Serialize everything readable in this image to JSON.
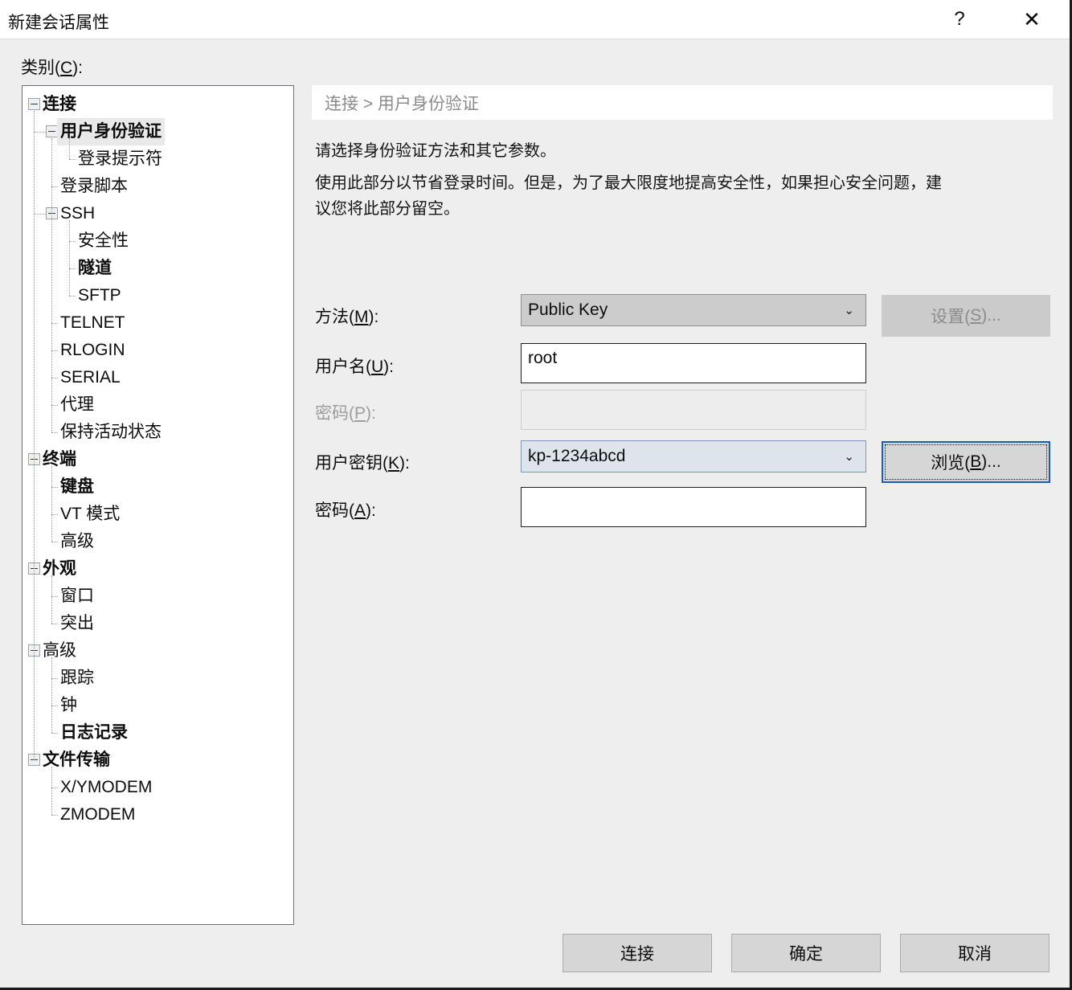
{
  "window": {
    "title": "新建会话属性",
    "help_icon": "?",
    "close_icon": "✕"
  },
  "category": {
    "label_pre": "类别(",
    "label_key": "C",
    "label_post": "):"
  },
  "tree": {
    "items": [
      {
        "label": "连接",
        "level": 0,
        "expander": true,
        "bold": true,
        "selected": false
      },
      {
        "label": "用户身份验证",
        "level": 1,
        "expander": true,
        "bold": true,
        "selected": true
      },
      {
        "label": "登录提示符",
        "level": 2,
        "expander": false,
        "bold": false,
        "selected": false
      },
      {
        "label": "登录脚本",
        "level": 1,
        "expander": false,
        "bold": false,
        "selected": false
      },
      {
        "label": "SSH",
        "level": 1,
        "expander": true,
        "bold": false,
        "selected": false
      },
      {
        "label": "安全性",
        "level": 2,
        "expander": false,
        "bold": false,
        "selected": false
      },
      {
        "label": "隧道",
        "level": 2,
        "expander": false,
        "bold": true,
        "selected": false
      },
      {
        "label": "SFTP",
        "level": 2,
        "expander": false,
        "bold": false,
        "selected": false
      },
      {
        "label": "TELNET",
        "level": 1,
        "expander": false,
        "bold": false,
        "selected": false
      },
      {
        "label": "RLOGIN",
        "level": 1,
        "expander": false,
        "bold": false,
        "selected": false
      },
      {
        "label": "SERIAL",
        "level": 1,
        "expander": false,
        "bold": false,
        "selected": false
      },
      {
        "label": "代理",
        "level": 1,
        "expander": false,
        "bold": false,
        "selected": false
      },
      {
        "label": "保持活动状态",
        "level": 1,
        "expander": false,
        "bold": false,
        "selected": false
      },
      {
        "label": "终端",
        "level": 0,
        "expander": true,
        "bold": true,
        "selected": false
      },
      {
        "label": "键盘",
        "level": 1,
        "expander": false,
        "bold": true,
        "selected": false
      },
      {
        "label": "VT 模式",
        "level": 1,
        "expander": false,
        "bold": false,
        "selected": false
      },
      {
        "label": "高级",
        "level": 1,
        "expander": false,
        "bold": false,
        "selected": false
      },
      {
        "label": "外观",
        "level": 0,
        "expander": true,
        "bold": true,
        "selected": false
      },
      {
        "label": "窗口",
        "level": 1,
        "expander": false,
        "bold": false,
        "selected": false
      },
      {
        "label": "突出",
        "level": 1,
        "expander": false,
        "bold": false,
        "selected": false
      },
      {
        "label": "高级",
        "level": 0,
        "expander": true,
        "bold": false,
        "selected": false
      },
      {
        "label": "跟踪",
        "level": 1,
        "expander": false,
        "bold": false,
        "selected": false
      },
      {
        "label": "钟",
        "level": 1,
        "expander": false,
        "bold": false,
        "selected": false
      },
      {
        "label": "日志记录",
        "level": 1,
        "expander": false,
        "bold": true,
        "selected": false
      },
      {
        "label": "文件传输",
        "level": 0,
        "expander": true,
        "bold": true,
        "selected": false
      },
      {
        "label": "X/YMODEM",
        "level": 1,
        "expander": false,
        "bold": false,
        "selected": false
      },
      {
        "label": "ZMODEM",
        "level": 1,
        "expander": false,
        "bold": false,
        "selected": false
      }
    ]
  },
  "content": {
    "breadcrumb": "连接  >  用户身份验证",
    "description_1": "请选择身份验证方法和其它参数。",
    "description_2": "使用此部分以节省登录时间。但是，为了最大限度地提高安全性，如果担心安全问题，建议您将此部分留空。",
    "fields": {
      "method": {
        "label_pre": "方法(",
        "label_key": "M",
        "label_post": "):",
        "value": "Public Key",
        "arrow": "⌄"
      },
      "username": {
        "label_pre": "用户名(",
        "label_key": "U",
        "label_post": "):",
        "value": "root"
      },
      "password": {
        "label_pre": "密码(",
        "label_key": "P",
        "label_post": "):",
        "value": ""
      },
      "user_key": {
        "label_pre": "用户密钥(",
        "label_key": "K",
        "label_post": "):",
        "value": "kp-1234abcd",
        "arrow": "⌄"
      },
      "passphrase": {
        "label_pre": "密码(",
        "label_key": "A",
        "label_post": "):",
        "value": ""
      }
    },
    "buttons": {
      "settings": {
        "pre": "设置(",
        "key": "S",
        "post": ")..."
      },
      "browse": {
        "pre": "浏览(",
        "key": "B",
        "post": ")..."
      }
    }
  },
  "footer": {
    "connect": "连接",
    "ok": "确定",
    "cancel": "取消"
  },
  "colors": {
    "dialog_bg": "#eeeeee",
    "accent_focus": "#1a5fb4",
    "combo_focus_bg": "#dde4ec",
    "disabled_text": "#9d9d9d"
  }
}
